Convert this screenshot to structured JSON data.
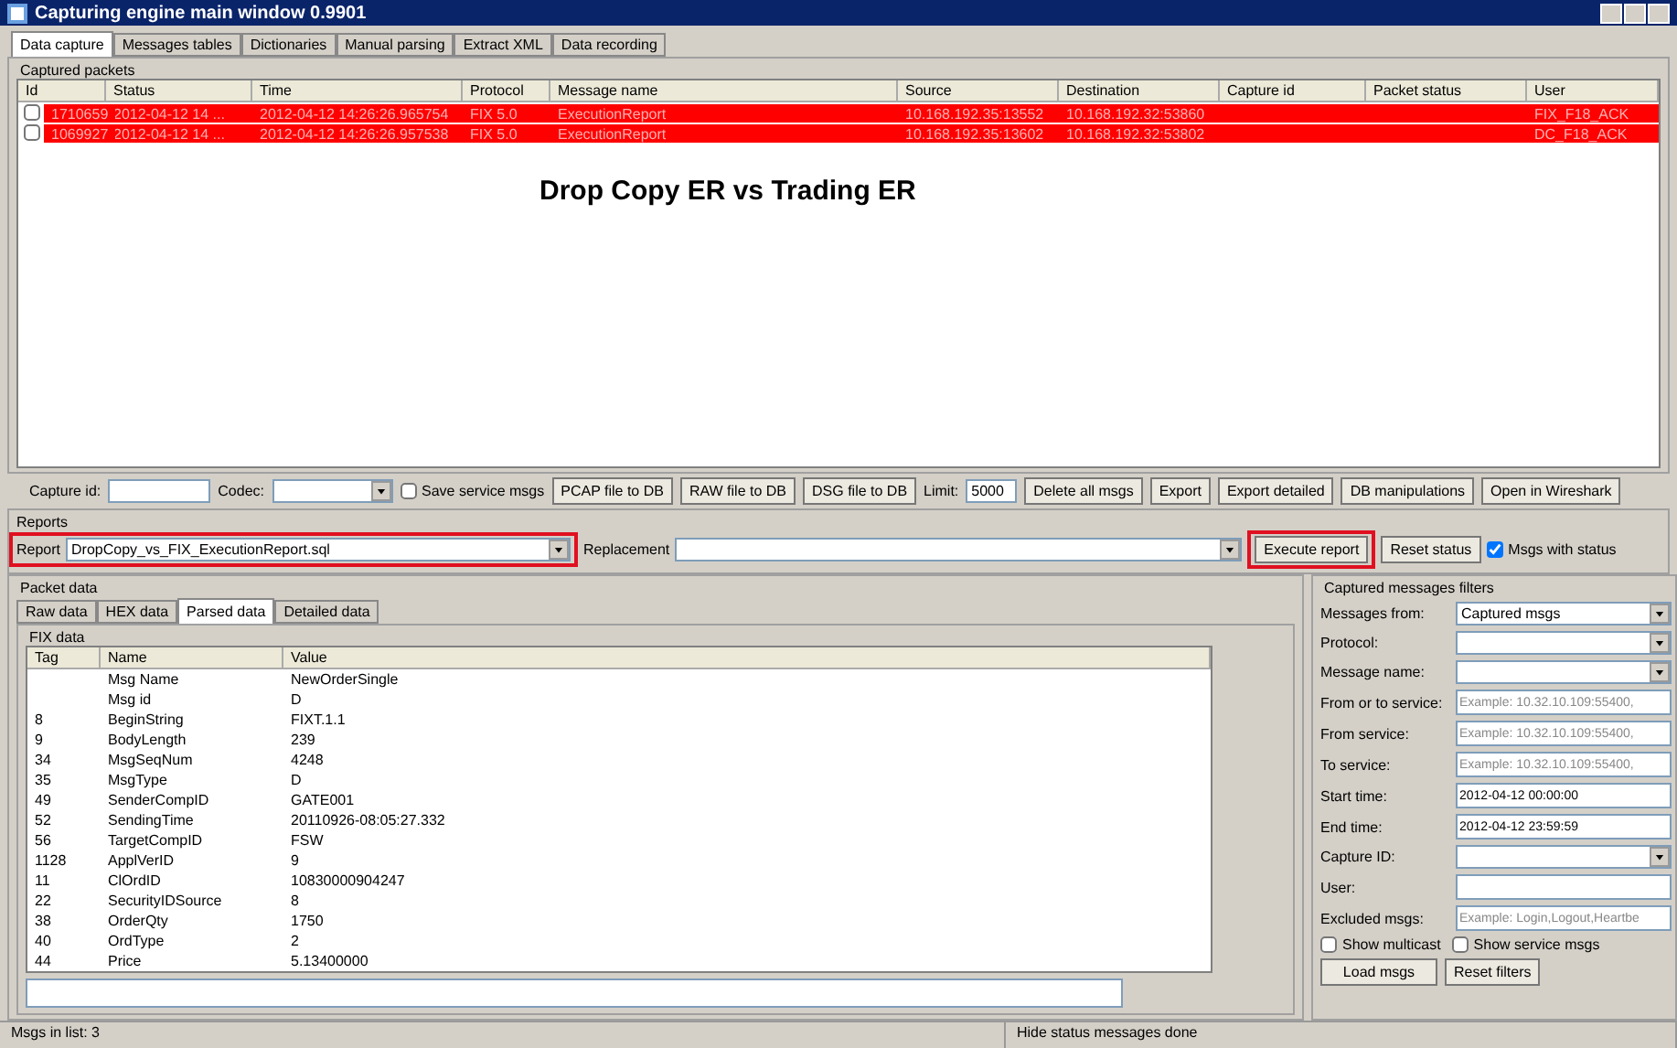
{
  "window": {
    "title": "Capturing engine main window 0.9901"
  },
  "tabs": [
    {
      "label": "Data capture",
      "selected": true
    },
    {
      "label": "Messages tables",
      "selected": false
    },
    {
      "label": "Dictionaries",
      "selected": false
    },
    {
      "label": "Manual parsing",
      "selected": false
    },
    {
      "label": "Extract XML",
      "selected": false
    },
    {
      "label": "Data recording",
      "selected": false
    }
  ],
  "captured_packets": {
    "title": "Captured packets",
    "columns": [
      "Id",
      "Status",
      "Time",
      "Protocol",
      "Message name",
      "Source",
      "Destination",
      "Capture id",
      "Packet status",
      "User"
    ],
    "rows": [
      {
        "checked": false,
        "cells": [
          "1710659",
          "2012-04-12 14 ...",
          "2012-04-12 14:26:26.965754",
          "FIX 5.0",
          "ExecutionReport",
          "10.168.192.35:13552",
          "10.168.192.32:53860",
          "",
          "",
          "FIX_F18_ACK"
        ]
      },
      {
        "checked": false,
        "cells": [
          "1069927",
          "2012-04-12 14 ...",
          "2012-04-12 14:26:26.957538",
          "FIX 5.0",
          "ExecutionReport",
          "10.168.192.35:13602",
          "10.168.192.32:53802",
          "",
          "",
          "DC_F18_ACK"
        ]
      }
    ],
    "overlay_caption": "Drop Copy ER **vs** Trading ER"
  },
  "toolbar": {
    "capture_id_label": "Capture id:",
    "codec_label": "Codec:",
    "save_service_msgs": {
      "label": "Save service msgs",
      "checked": false
    },
    "buttons_left": [
      "PCAP file to DB",
      "RAW file to DB",
      "DSG file to DB"
    ],
    "limit_label": "Limit:",
    "limit_value": "5000",
    "buttons_right": [
      "Delete all msgs",
      "Export",
      "Export detailed",
      "DB manipulations",
      "Open in Wireshark"
    ]
  },
  "reports": {
    "title": "Reports",
    "report_label": "Report",
    "report_value": "DropCopy_vs_FIX_ExecutionReport.sql",
    "report_highlighted": true,
    "replacement_label": "Replacement",
    "execute_button": "Execute report",
    "execute_highlighted": true,
    "reset_button": "Reset status",
    "msgs_with_status": {
      "label": "Msgs with status",
      "checked": true
    }
  },
  "packet_data": {
    "title": "Packet data",
    "tabs": [
      {
        "label": "Raw data",
        "selected": false
      },
      {
        "label": "HEX data",
        "selected": false
      },
      {
        "label": "Parsed data",
        "selected": true
      },
      {
        "label": "Detailed data",
        "selected": false
      }
    ],
    "fix_title": "FIX data",
    "columns": [
      "Tag",
      "Name",
      "Value"
    ],
    "rows": [
      [
        "",
        "Msg Name",
        "NewOrderSingle"
      ],
      [
        "",
        "Msg id",
        "D"
      ],
      [
        "8",
        "BeginString",
        "FIXT.1.1"
      ],
      [
        "9",
        "BodyLength",
        "239"
      ],
      [
        "34",
        "MsgSeqNum",
        "4248"
      ],
      [
        "35",
        "MsgType",
        "D"
      ],
      [
        "49",
        "SenderCompID",
        "GATE001"
      ],
      [
        "52",
        "SendingTime",
        "20110926-08:05:27.332"
      ],
      [
        "56",
        "TargetCompID",
        "FSW"
      ],
      [
        "1128",
        "ApplVerID",
        "9"
      ],
      [
        "11",
        "ClOrdID",
        "10830000904247"
      ],
      [
        "22",
        "SecurityIDSource",
        "8"
      ],
      [
        "38",
        "OrderQty",
        "1750"
      ],
      [
        "40",
        "OrdType",
        "2"
      ],
      [
        "44",
        "Price",
        "5.13400000"
      ]
    ]
  },
  "filters": {
    "title": "Captured messages filters",
    "fields": [
      {
        "kind": "combo",
        "label": "Messages from:",
        "value": "Captured msgs"
      },
      {
        "kind": "combo",
        "label": "Protocol:"
      },
      {
        "kind": "combo",
        "label": "Message name:"
      },
      {
        "kind": "text",
        "label": "From or to service:",
        "placeholder": "Example: 10.32.10.109:55400,"
      },
      {
        "kind": "text",
        "label": "From service:",
        "placeholder": "Example: 10.32.10.109:55400,"
      },
      {
        "kind": "text",
        "label": "To service:",
        "placeholder": "Example: 10.32.10.109:55400,"
      },
      {
        "kind": "text",
        "label": "Start time:",
        "value": "2012-04-12 00:00:00"
      },
      {
        "kind": "text",
        "label": "End time:",
        "value": "2012-04-12 23:59:59"
      },
      {
        "kind": "combo",
        "label": "Capture ID:"
      },
      {
        "kind": "text",
        "label": "User:"
      },
      {
        "kind": "text",
        "label": "Excluded msgs:",
        "placeholder": "Example: Login,Logout,Heartbe"
      }
    ],
    "checks": [
      {
        "label": "Show multicast",
        "checked": false
      },
      {
        "label": "Show service msgs",
        "checked": false
      }
    ],
    "buttons": [
      "Load msgs",
      "Reset filters"
    ]
  },
  "status_bar": [
    "Msgs in list: 3",
    "Hide status messages done"
  ]
}
